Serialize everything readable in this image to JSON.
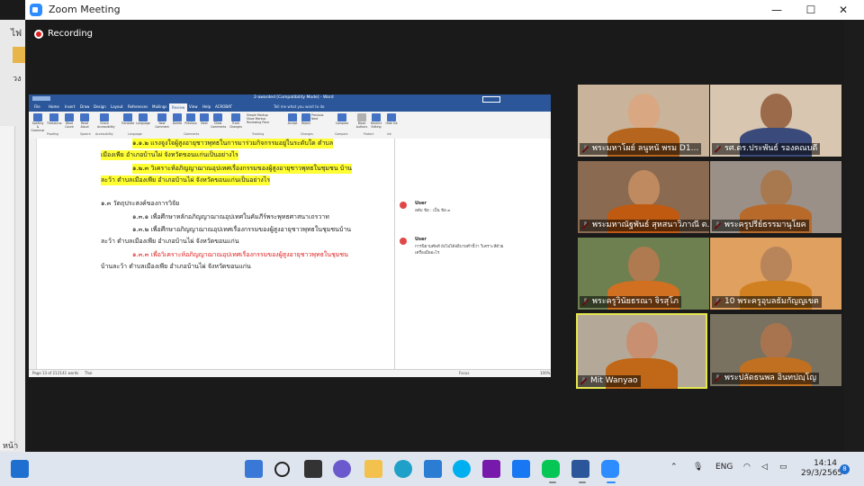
{
  "zoom": {
    "title": "Zoom Meeting",
    "recording_label": "Recording",
    "window_buttons": {
      "minimize": "—",
      "maximize": "☐",
      "close": "✕"
    }
  },
  "desktop": {
    "left_top_text": "ไฟ",
    "left_folder_text": "วง",
    "bottom_left_text": "หน้า 2"
  },
  "word": {
    "doc_title": "2-awarded [Compatibility Mode] - Word",
    "tell_me": "Tell me what you want to do",
    "tabs": [
      "File",
      "Home",
      "Insert",
      "Draw",
      "Design",
      "Layout",
      "References",
      "Mailings",
      "Review",
      "View",
      "Help",
      "ACROBAT"
    ],
    "active_tab": "Review",
    "ribbon_buttons": [
      "Spelling & Grammar",
      "Thesaurus",
      "Word Count",
      "Read Aloud",
      "Check Accessibility",
      "Translate",
      "Language",
      "New Comment",
      "Delete",
      "Previous",
      "Next",
      "Show Comments",
      "Track Changes",
      "Simple Markup",
      "Show Markup",
      "Reviewing Pane",
      "Accept",
      "Reject",
      "Previous",
      "Next",
      "Compare",
      "Block Authors",
      "Restrict Editing",
      "Hide Ink"
    ],
    "ribbon_groups": [
      "Proofing",
      "Speech",
      "Accessibility",
      "Language",
      "Comments",
      "Tracking",
      "Changes",
      "Compare",
      "Protect",
      "Ink"
    ],
    "lines": [
      "๑.๑.๒ แรงจูงใจผู้สูงอายุชาวพุทธในการมาร่วมกิจกรรมอยู่ในระดับใด ตำบล",
      "เมืองเพีย อำเภอบ้านไผ่ จังหวัดขอนแก่นเป็นอย่างไร",
      "๑.๒.๓ วิเคราะห์อภิญญาฌาณอุปเทศเรื่องกรรมของผู้สูงอายุชาวพุทธในชุมชน บ้าน",
      "ละว้า ตำบลเมืองเพีย อำเภอบ้านไผ่ จังหวัดขอนแก่นเป็นอย่างไร",
      "๑.๓ วัตถุประสงค์ของการวิจัย",
      "๑.๓.๑ เพื่อศึกษาหลักอภิญญาฌาณอุปเทศในคัมภีร์พระพุทธศาสนาเถรวาท",
      "๑.๓.๒ เพื่อศึกษาอภิญญาฌาณอุปเทศเรื่องกรรมของผู้สูงอายุชาวพุทธในชุมชนบ้าน",
      "ละว้า ตำบลเมืองเพีย อำเภอบ้านไผ่ จังหวัดขอนแก่น",
      "๑.๓.๓ เพื่อวิเคราะห์อภิญญาฌาณอุปเทศเรื่องกรรมของผู้สูงอายุชาวพุทธในชุมชน",
      "บ้านละว้า ตำบลเมืองเพีย อำเภอบ้านไผ่ จังหวัดขอนแก่น"
    ],
    "comments": [
      {
        "user": "User",
        "text": "ลดับ ข้อ : เป็น ข้อ ๓"
      },
      {
        "user": "User",
        "text": "การนิยามศัพท์ ยังไม่ได้อธิบายคำนี้ว่า วิเคราะห์ด้วย"
      },
      {
        "user": "",
        "text": "เครื่องมืออะไร"
      }
    ],
    "status": {
      "page": "Page 13 of 21",
      "words": "2141 words",
      "lang": "Thai",
      "focus": "Focus",
      "zoom": "100%"
    }
  },
  "participants": [
    {
      "name": "พระมหาโผย์ ลนูหนั พรม D1...",
      "bg": "#c9b39a",
      "skin": "#d9a882",
      "robe": "#b5651d",
      "muted": true
    },
    {
      "name": "รศ.ดร.ประพันธ์ รองคณบดี",
      "bg": "#d8c6b0",
      "skin": "#9a6a4a",
      "robe": "#3a4a7a",
      "muted": true
    },
    {
      "name": "พระมหาณัฐพันธ์ สุหสนาวิภาณี ต...",
      "bg": "#8a6a50",
      "skin": "#c08a60",
      "robe": "#c05a10",
      "muted": true
    },
    {
      "name": "พระครูปรีย์ธรรมานุโยค",
      "bg": "#9a9088",
      "skin": "#a8784f",
      "robe": "#b86a2a",
      "muted": true
    },
    {
      "name": "พระครูวินัยธรณา จิรสุโภ",
      "bg": "#6e8050",
      "skin": "#b07a50",
      "robe": "#d07020",
      "muted": true
    },
    {
      "name": "10 พระครูอุบลธัมกัญญเขต",
      "bg": "#e0a060",
      "skin": "#b8845a",
      "robe": "#d08020",
      "muted": true
    },
    {
      "name": "Mit Wanyao",
      "bg": "#b4a898",
      "skin": "#c89070",
      "robe": "#c06818",
      "muted": true
    },
    {
      "name": "พระปลัดธนพล อินทปญฺโญ",
      "bg": "#7a7260",
      "skin": "#a87450",
      "robe": "#c07020",
      "muted": true
    }
  ],
  "taskbar": {
    "tray_lang": "ENG",
    "time": "14:14",
    "date": "29/3/2565",
    "notifications": "8",
    "apps": [
      "widgets",
      "start",
      "search",
      "task-view",
      "chat",
      "file-explorer",
      "edge",
      "mail",
      "skype",
      "onenote",
      "facebook",
      "line",
      "word",
      "zoom"
    ]
  }
}
